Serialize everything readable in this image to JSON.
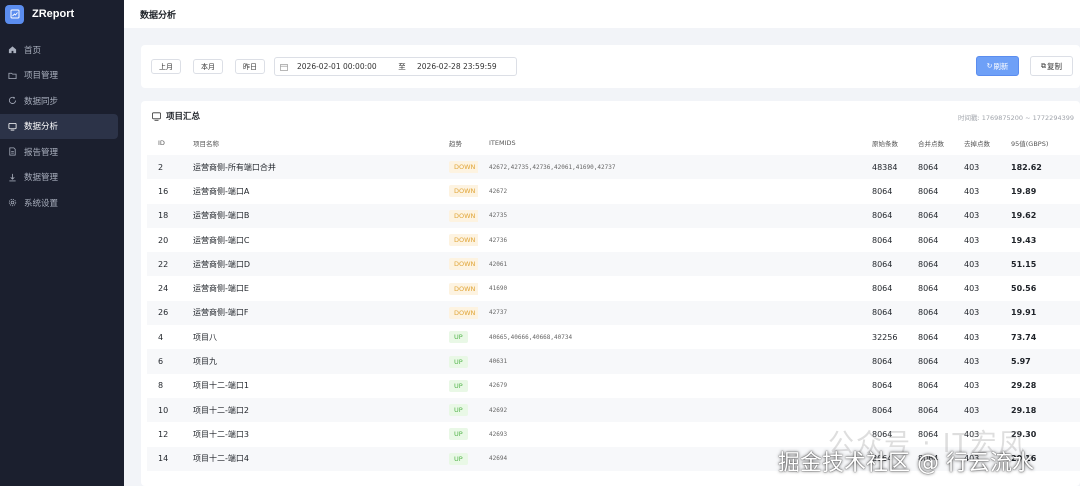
{
  "app": {
    "name": "ZReport"
  },
  "sidebar": {
    "items": [
      {
        "label": "首页",
        "icon": "home-icon"
      },
      {
        "label": "项目管理",
        "icon": "folder-icon"
      },
      {
        "label": "数据同步",
        "icon": "sync-icon"
      },
      {
        "label": "数据分析",
        "icon": "chart-icon",
        "active": true
      },
      {
        "label": "报告管理",
        "icon": "document-icon"
      },
      {
        "label": "数据管理",
        "icon": "download-icon"
      },
      {
        "label": "系统设置",
        "icon": "gear-icon"
      }
    ]
  },
  "header": {
    "title": "数据分析"
  },
  "filter": {
    "last_month": "上月",
    "this_month": "本月",
    "today": "昨日",
    "start": "2026-02-01 00:00:00",
    "separator": "至",
    "end": "2026-02-28 23:59:59",
    "refresh_label": "刷新",
    "copy_label": "复制"
  },
  "summary": {
    "title": "项目汇总",
    "time_range": "时间戳: 1769875200 ~ 1772294399",
    "columns": [
      "ID",
      "项目名称",
      "趋势",
      "ITEMIDS",
      "原始条数",
      "合并点数",
      "去掉点数",
      "95值(GBPS)"
    ],
    "rows": [
      {
        "id": "2",
        "name": "运营商侧-所有端口合并",
        "trend": "DOWN",
        "itemids": "42672,42735,42736,42061,41690,42737",
        "raw": "48384",
        "merged": "8064",
        "removed": "403",
        "p95": "182.62"
      },
      {
        "id": "16",
        "name": "运营商侧-端口A",
        "trend": "DOWN",
        "itemids": "42672",
        "raw": "8064",
        "merged": "8064",
        "removed": "403",
        "p95": "19.89"
      },
      {
        "id": "18",
        "name": "运营商侧-端口B",
        "trend": "DOWN",
        "itemids": "42735",
        "raw": "8064",
        "merged": "8064",
        "removed": "403",
        "p95": "19.62"
      },
      {
        "id": "20",
        "name": "运营商侧-端口C",
        "trend": "DOWN",
        "itemids": "42736",
        "raw": "8064",
        "merged": "8064",
        "removed": "403",
        "p95": "19.43"
      },
      {
        "id": "22",
        "name": "运营商侧-端口D",
        "trend": "DOWN",
        "itemids": "42061",
        "raw": "8064",
        "merged": "8064",
        "removed": "403",
        "p95": "51.15"
      },
      {
        "id": "24",
        "name": "运营商侧-端口E",
        "trend": "DOWN",
        "itemids": "41690",
        "raw": "8064",
        "merged": "8064",
        "removed": "403",
        "p95": "50.56"
      },
      {
        "id": "26",
        "name": "运营商侧-端口F",
        "trend": "DOWN",
        "itemids": "42737",
        "raw": "8064",
        "merged": "8064",
        "removed": "403",
        "p95": "19.91"
      },
      {
        "id": "4",
        "name": "项目八",
        "trend": "UP",
        "itemids": "40665,40666,40668,40734",
        "raw": "32256",
        "merged": "8064",
        "removed": "403",
        "p95": "73.74"
      },
      {
        "id": "6",
        "name": "项目九",
        "trend": "UP",
        "itemids": "40631",
        "raw": "8064",
        "merged": "8064",
        "removed": "403",
        "p95": "5.97"
      },
      {
        "id": "8",
        "name": "项目十二-端口1",
        "trend": "UP",
        "itemids": "42679",
        "raw": "8064",
        "merged": "8064",
        "removed": "403",
        "p95": "29.28"
      },
      {
        "id": "10",
        "name": "项目十二-端口2",
        "trend": "UP",
        "itemids": "42692",
        "raw": "8064",
        "merged": "8064",
        "removed": "403",
        "p95": "29.18"
      },
      {
        "id": "12",
        "name": "项目十二-端口3",
        "trend": "UP",
        "itemids": "42693",
        "raw": "8064",
        "merged": "8064",
        "removed": "403",
        "p95": "29.30"
      },
      {
        "id": "14",
        "name": "项目十二-端口4",
        "trend": "UP",
        "itemids": "42694",
        "raw": "8064",
        "merged": "8064",
        "removed": "403",
        "p95": "29.16"
      }
    ]
  },
  "watermark": {
    "line1": "公众号 · IT宏凤",
    "line2": "掘金技术社区 @ 行云流水"
  }
}
